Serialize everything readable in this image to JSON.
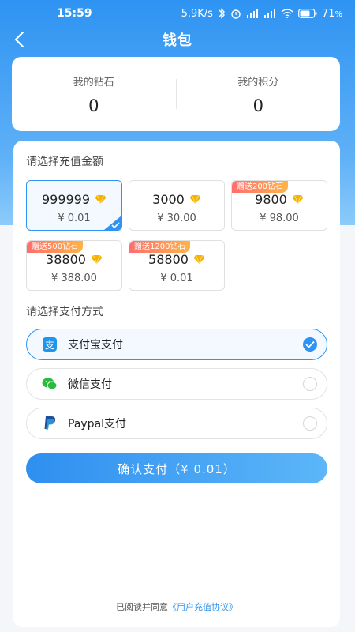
{
  "status_bar": {
    "time": "15:59",
    "network_speed": "5.9K/s",
    "battery": "71"
  },
  "nav": {
    "title": "钱包"
  },
  "summary": {
    "diamonds_label": "我的钻石",
    "diamonds_value": "0",
    "points_label": "我的积分",
    "points_value": "0"
  },
  "recharge": {
    "section_label": "请选择充值金额",
    "packages": [
      {
        "amount": "999999",
        "price": "¥ 0.01",
        "bonus": "",
        "selected": true
      },
      {
        "amount": "3000",
        "price": "¥ 30.00",
        "bonus": "",
        "selected": false
      },
      {
        "amount": "9800",
        "price": "¥ 98.00",
        "bonus": "赠送200钻石",
        "selected": false
      },
      {
        "amount": "38800",
        "price": "¥ 388.00",
        "bonus": "赠送500钻石",
        "selected": false
      },
      {
        "amount": "58800",
        "price": "¥ 0.01",
        "bonus": "赠送1200钻石",
        "selected": false
      }
    ]
  },
  "payment": {
    "section_label": "请选择支付方式",
    "methods": [
      {
        "label": "支付宝支付",
        "icon": "alipay-icon",
        "selected": true
      },
      {
        "label": "微信支付",
        "icon": "wechat-icon",
        "selected": false
      },
      {
        "label": "Paypal支付",
        "icon": "paypal-icon",
        "selected": false
      }
    ]
  },
  "confirm_label": "确认支付（¥ 0.01）",
  "agreement": {
    "prefix": "已阅读并同意",
    "link": "《用户充值协议》"
  },
  "colors": {
    "accent": "#2e93f2",
    "diamond": "#f5b301",
    "bonus_start": "#ff6e6e",
    "bonus_end": "#ffb347"
  }
}
